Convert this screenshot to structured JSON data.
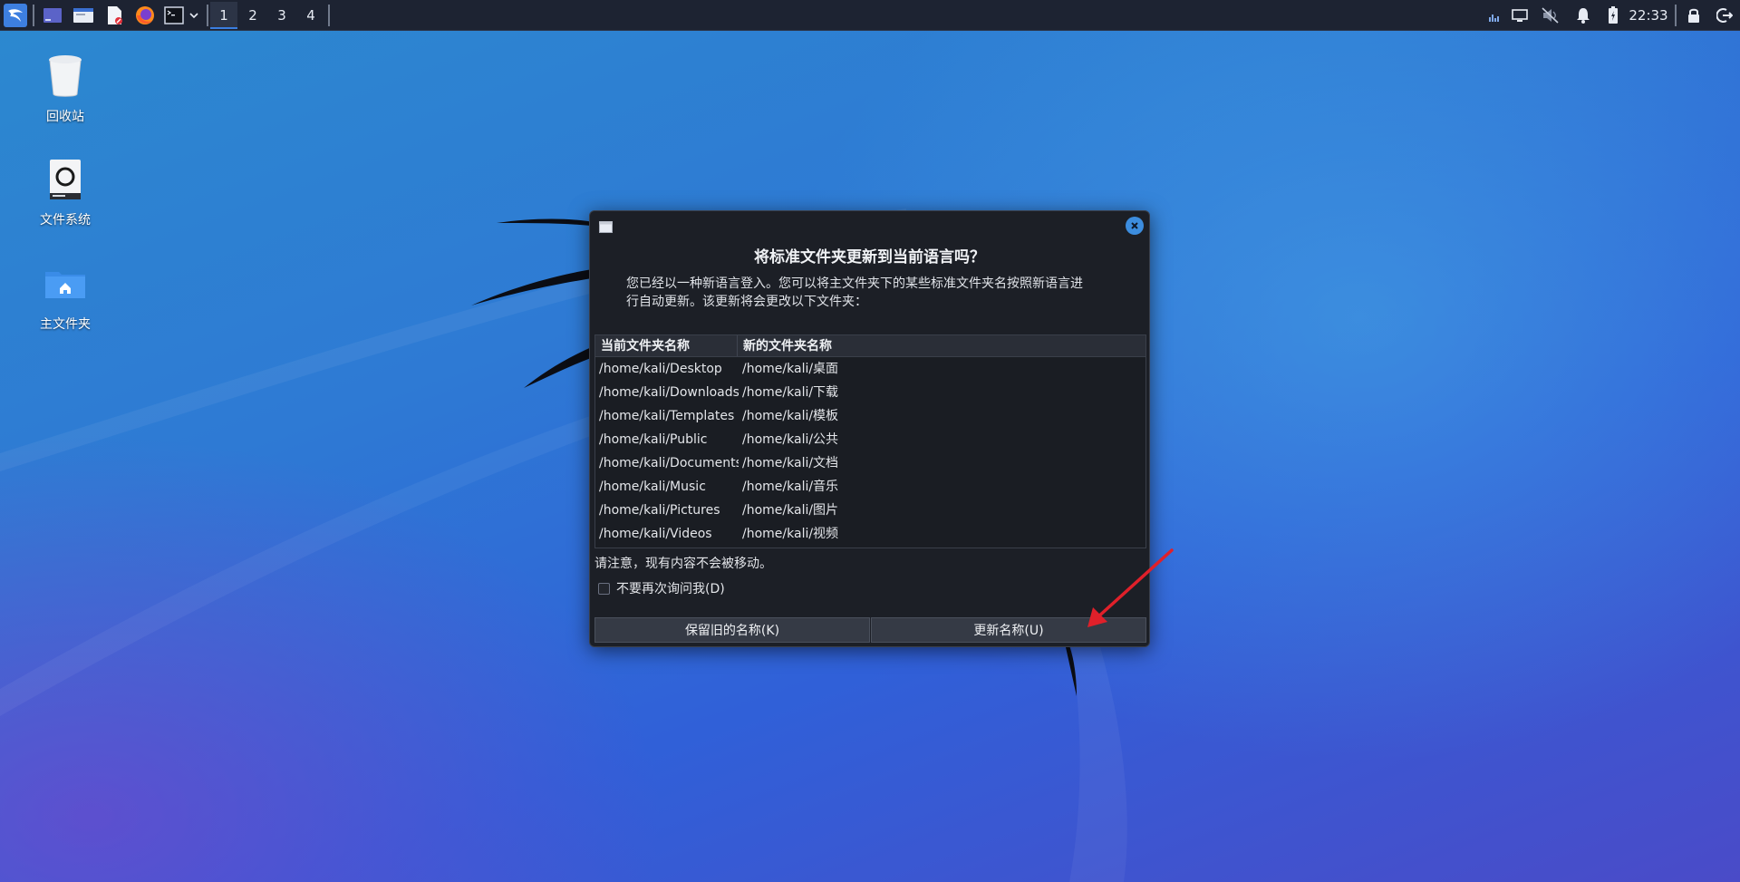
{
  "panel": {
    "workspaces": [
      "1",
      "2",
      "3",
      "4"
    ],
    "active_workspace": "1",
    "clock": "22:33",
    "launchers": [
      "kali-menu-icon",
      "desktop-icon",
      "file-manager-icon",
      "text-editor-icon",
      "firefox-icon",
      "terminal-icon",
      "chevron-down-icon"
    ],
    "tray_icons": [
      "network-graph-icon",
      "display-icon",
      "volume-muted-icon",
      "bell-icon",
      "battery-icon",
      "lock-icon",
      "logout-icon"
    ]
  },
  "desktop": {
    "icons": [
      {
        "label": "回收站",
        "icon": "trash-icon"
      },
      {
        "label": "文件系统",
        "icon": "drive-icon"
      },
      {
        "label": "主文件夹",
        "icon": "home-folder-icon"
      }
    ]
  },
  "dialog": {
    "title": "将标准文件夹更新到当前语言吗？",
    "description_line1": "您已经以一种新语言登入。您可以将主文件夹下的某些标准文件夹名按照新语言进",
    "description_line2": "行自动更新。该更新将会更改以下文件夹：",
    "columns": [
      "当前文件夹名称",
      "新的文件夹名称"
    ],
    "rows": [
      {
        "current": "/home/kali/Desktop",
        "new": "/home/kali/桌面"
      },
      {
        "current": "/home/kali/Downloads",
        "new": "/home/kali/下载"
      },
      {
        "current": "/home/kali/Templates",
        "new": "/home/kali/模板"
      },
      {
        "current": "/home/kali/Public",
        "new": "/home/kali/公共"
      },
      {
        "current": "/home/kali/Documents",
        "new": "/home/kali/文档"
      },
      {
        "current": "/home/kali/Music",
        "new": "/home/kali/音乐"
      },
      {
        "current": "/home/kali/Pictures",
        "new": "/home/kali/图片"
      },
      {
        "current": "/home/kali/Videos",
        "new": "/home/kali/视频"
      }
    ],
    "note": "请注意，现有内容不会被移动。",
    "checkbox_label": "不要再次询问我(D)",
    "checkbox_checked": false,
    "keep_button": "保留旧的名称(K)",
    "update_button": "更新名称(U)"
  },
  "colors": {
    "panel_bg": "#1d2332",
    "dialog_bg": "#1c1f26",
    "accent": "#3c8ddf",
    "annotation_arrow": "#e0202a"
  }
}
